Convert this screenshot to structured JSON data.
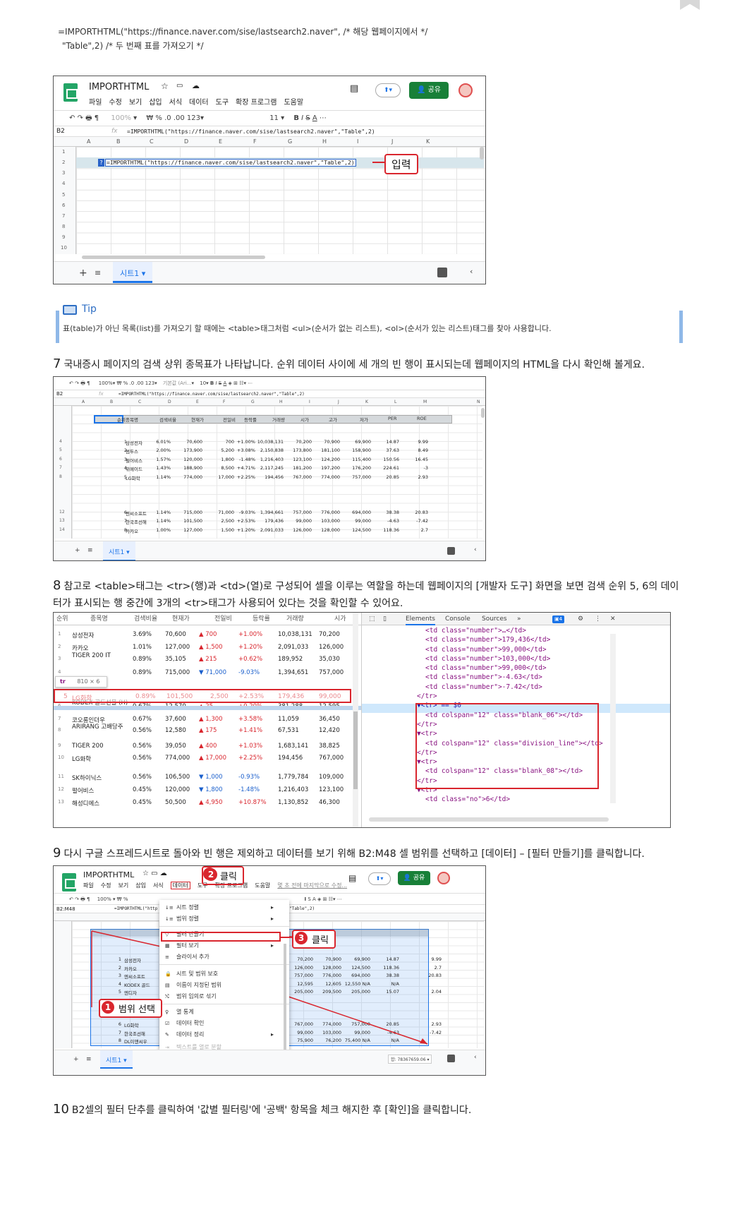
{
  "code_lines": [
    "=IMPORTHTML(\"https://finance.naver.com/sise/lastsearch2.naver\", /* 해당 웹페이지에서 */",
    "\"Table\",2) /* 두 번째 표를 가져오기 */"
  ],
  "sheet1": {
    "title": "IMPORTHTML",
    "menu": [
      "파일",
      "수정",
      "보기",
      "삽입",
      "서식",
      "데이터",
      "도구",
      "확장 프로그램",
      "도움말"
    ],
    "share": "공유",
    "zoom": "100%",
    "font_size": "11",
    "cell_ref": "B2",
    "formula": "=IMPORTHTML(\"https://finance.naver.com/sise/lastsearch2.naver\",\"Table\",2)",
    "cols": [
      "A",
      "B",
      "C",
      "D",
      "E",
      "F",
      "G",
      "H",
      "I",
      "J",
      "K"
    ],
    "rows": [
      "1",
      "2",
      "3",
      "4",
      "5",
      "6",
      "7",
      "8",
      "9",
      "10"
    ],
    "sheet_tab": "시트1",
    "callout": "입력"
  },
  "tip": {
    "title": "Tip",
    "text": "표(table)가 아닌 목록(list)를 가져오기 할 때에는 <table>태그처럼 <ul>(순서가 없는 리스트), <ol>(순서가 있는 리스트)태그를 찾아 사용합니다."
  },
  "step7": {
    "num": "7",
    "text": "국내증시 페이지의 검색 상위 종목표가 나타납니다. 순위 데이터 사이에 세 개의 빈 행이 표시되는데 웹페이지의 HTML을 다시 확인해 볼게요."
  },
  "sheet2": {
    "cell_ref": "B2",
    "formula": "=IMPORTHTML(\"https://finance.naver.com/sise/lastsearch2.naver\",\"Table\",2)",
    "font": "기본값 (Ari...",
    "font_size": "10",
    "zoom": "100%",
    "cols": [
      "A",
      "B",
      "C",
      "D",
      "E",
      "F",
      "G",
      "H",
      "I",
      "J",
      "K",
      "L",
      "M",
      "N"
    ],
    "headers": [
      "순위",
      "종목명",
      "검색비율",
      "현재가",
      "전일비",
      "등락률",
      "거래량",
      "시가",
      "고가",
      "저가",
      "PER",
      "ROE"
    ],
    "rows": [
      {
        "r": "4",
        "d": [
          "1",
          "삼성전자",
          "6.01%",
          "70,600",
          "700",
          "+1.00%",
          "10,038,131",
          "70,200",
          "70,900",
          "69,900",
          "14.87",
          "9.99"
        ]
      },
      {
        "r": "5",
        "d": [
          "2",
          "썸두스",
          "2.00%",
          "173,900",
          "5,200",
          "+3.08%",
          "2,150,838",
          "173,800",
          "181,100",
          "158,900",
          "37.63",
          "8.49"
        ]
      },
      {
        "r": "6",
        "d": [
          "3",
          "펄어비스",
          "1.57%",
          "120,000",
          "1,800",
          "-1.48%",
          "1,216,403",
          "123,100",
          "124,200",
          "115,400",
          "150.56",
          "16.45"
        ]
      },
      {
        "r": "7",
        "d": [
          "4",
          "위메이드",
          "1.43%",
          "188,900",
          "8,500",
          "+4.71%",
          "2,117,245",
          "181,200",
          "197,200",
          "176,200",
          "224.61",
          "-3"
        ]
      },
      {
        "r": "8",
        "d": [
          "5",
          "LG화학",
          "1.14%",
          "774,000",
          "17,000",
          "+2.25%",
          "194,456",
          "767,000",
          "774,000",
          "757,000",
          "20.85",
          "2.93"
        ]
      },
      {
        "r": "12",
        "d": [
          "6",
          "엔씨소프트",
          "1.14%",
          "715,000",
          "71,000",
          "-9.03%",
          "1,394,661",
          "757,000",
          "776,000",
          "694,000",
          "38.38",
          "20.83"
        ]
      },
      {
        "r": "13",
        "d": [
          "7",
          "한국조선해",
          "1.14%",
          "101,500",
          "2,500",
          "+2.53%",
          "179,436",
          "99,000",
          "103,000",
          "99,000",
          "-4.63",
          "-7.42"
        ]
      },
      {
        "r": "14",
        "d": [
          "8",
          "카카오",
          "1.00%",
          "127,000",
          "1,500",
          "+1.20%",
          "2,091,033",
          "126,000",
          "128,000",
          "124,500",
          "118.36",
          "2.7"
        ]
      }
    ],
    "sheet_tab": "시트1"
  },
  "step8": {
    "num": "8",
    "text": "참고로 <table>태그는 <tr>(행)과 <td>(열)로 구성되어 셀을 이루는 역할을 하는데 웹페이지의 [개발자 도구] 화면을 보면 검색 순위 5, 6의 데이터가 표시되는 행 중간에 3개의 <tr>태그가 사용되어 있다는 것을 확인할 수 있어요."
  },
  "devtools": {
    "headers": [
      "순위",
      "종목명",
      "검색비율",
      "현재가",
      "전일비",
      "등락률",
      "거래량",
      "시가"
    ],
    "rows": [
      [
        "1",
        "삼성전자",
        "3.69%",
        "70,600",
        "▲ 700",
        "+1.00%",
        "10,038,131",
        "70,200"
      ],
      [
        "2",
        "카카오",
        "1.01%",
        "127,000",
        "▲ 1,500",
        "+1.20%",
        "2,091,033",
        "126,000"
      ],
      [
        "3",
        "TIGER 200 IT",
        "0.89%",
        "35,105",
        "▲ 215",
        "+0.62%",
        "189,952",
        "35,030"
      ],
      [
        "4",
        "",
        "0.89%",
        "715,000",
        "▼ 71,000",
        "-9.03%",
        "1,394,651",
        "757,000"
      ],
      [
        "6",
        "KODEX 골드선물 (H)",
        "0.67%",
        "12,570",
        "▲ 25",
        "+0.20%",
        "381,288",
        "12,595"
      ],
      [
        "7",
        "코오롱인더우",
        "0.67%",
        "37,600",
        "▲ 1,300",
        "+3.58%",
        "11,059",
        "36,450"
      ],
      [
        "8",
        "ARIRANG 고배당주",
        "0.56%",
        "12,580",
        "▲ 175",
        "+1.41%",
        "67,531",
        "12,420"
      ],
      [
        "9",
        "TIGER 200",
        "0.56%",
        "39,050",
        "▲ 400",
        "+1.03%",
        "1,683,141",
        "38,825"
      ],
      [
        "10",
        "LG화학",
        "0.56%",
        "774,000",
        "▲ 17,000",
        "+2.25%",
        "194,456",
        "767,000"
      ],
      [
        "11",
        "SK하이닉스",
        "0.56%",
        "106,500",
        "▼ 1,000",
        "-0.93%",
        "1,779,784",
        "109,000"
      ],
      [
        "12",
        "펄어비스",
        "0.45%",
        "120,000",
        "▼ 1,800",
        "-1.48%",
        "1,216,403",
        "123,100"
      ],
      [
        "13",
        "해성디에스",
        "0.45%",
        "50,500",
        "▲ 4,950",
        "+10.87%",
        "1,130,852",
        "46,300"
      ]
    ],
    "struck": [
      "5",
      "LG화학",
      "0.89%",
      "101,500",
      "2,500",
      "+2.53%",
      "179,436",
      "99,000"
    ],
    "tooltip_tag": "tr",
    "tooltip_size": "810 × 6",
    "tabs": [
      "Elements",
      "Console",
      "Sources",
      "»"
    ],
    "badge": "4",
    "code": [
      "<td class=\"number\">…</td>",
      "<td class=\"number\">179,436</td>",
      "<td class=\"number\">99,000</td>",
      "<td class=\"number\">103,000</td>",
      "<td class=\"number\">99,000</td>",
      "<td class=\"number\">-4.63</td>",
      "<td class=\"number\">-7.42</td>",
      "</tr>",
      "▼<tr> == $0",
      "<td colspan=\"12\" class=\"blank_06\"></td>",
      "</tr>",
      "▼<tr>",
      "<td colspan=\"12\" class=\"division_line\"></td>",
      "</tr>",
      "▼<tr>",
      "<td colspan=\"12\" class=\"blank_08\"></td>",
      "</tr>",
      "▼<tr>",
      "<td class=\"no\">6</td>"
    ]
  },
  "step9": {
    "num": "9",
    "text": "다시 구글 스프레드시트로 돌아와 빈 행은 제외하고 데이터를 보기 위해 B2:M48 셀 범위를 선택하고 [데이터] – [필터 만들기]를 클릭합니다."
  },
  "sheet3": {
    "title": "IMPORTHTML",
    "menu": [
      "파일",
      "수정",
      "보기",
      "삽입",
      "서식",
      "데이터",
      "도구",
      "확장 프로그램",
      "도움말"
    ],
    "last_edit": "몇 초 전에 마지막으로 수정...",
    "share": "공유",
    "cell_ref": "B2:M48",
    "formula": "=IMPORTHTML(\"http",
    "formula_tail": "\"Table\",2)",
    "menu_items": [
      "시트 정렬",
      "범위 정렬",
      "필터 만들기",
      "필터 보기",
      "슬라이서 추가",
      "시트 및 범위 보호",
      "이름이 지정된 범위",
      "범위 임의로 섞기",
      "열 통계",
      "데이터 확인",
      "데이터 정리",
      "텍스트를 열로 분할"
    ],
    "callout1": "범위 선택",
    "callout2": "클릭",
    "callout3": "클릭",
    "n1": "1",
    "n2": "2",
    "n3": "3",
    "left_rows": [
      [
        "1",
        "삼성전자"
      ],
      [
        "2",
        "카카오"
      ],
      [
        "3",
        "엔씨소프트"
      ],
      [
        "4",
        "KODEX 골드"
      ],
      [
        "5",
        "엔디자"
      ],
      [
        "6",
        "LG화학"
      ],
      [
        "7",
        "한국조선해"
      ],
      [
        "8",
        "DL이앤씨우"
      ]
    ],
    "right_rows": [
      [
        "70,200",
        "70,900",
        "69,900",
        "14.87",
        "9.99"
      ],
      [
        "126,000",
        "128,000",
        "124,500",
        "118.36",
        "2.7"
      ],
      [
        "757,000",
        "776,000",
        "694,000",
        "38.38",
        "20.83"
      ],
      [
        "12,595",
        "12,605",
        "12,550 N/A",
        "N/A",
        ""
      ],
      [
        "205,000",
        "209,500",
        "205,000",
        "15.07",
        "2.04"
      ],
      [
        "767,000",
        "774,000",
        "757,000",
        "20.85",
        "2.93"
      ],
      [
        "99,000",
        "103,000",
        "99,000",
        "-4.63",
        "-7.42"
      ],
      [
        "75,900",
        "76,200",
        "75,400 N/A",
        "N/A",
        ""
      ]
    ],
    "sum": "합: 78367659.06",
    "sheet_tab": "시트1"
  },
  "step10": {
    "num": "10",
    "text": "B2셀의 필터 단추를 클릭하여 '값별 필터링'에 '공백' 항목을 체크 해지한 후 [확인]을 클릭합니다."
  }
}
